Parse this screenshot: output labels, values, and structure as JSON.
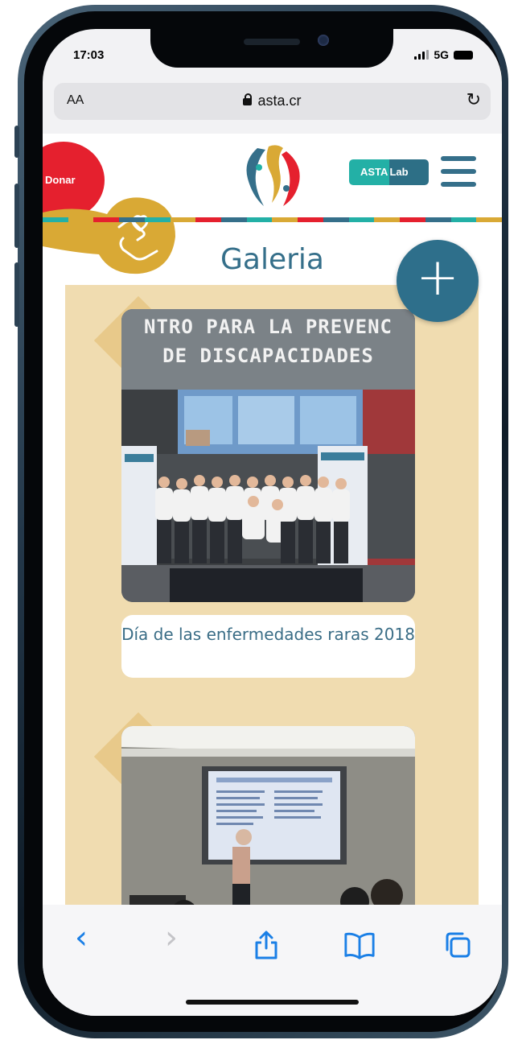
{
  "status_bar": {
    "time": "17:03",
    "network": "5G"
  },
  "browser": {
    "text_size": "AA",
    "domain": "asta.cr"
  },
  "header": {
    "donate_label": "Donar",
    "lab_part1": "ASTA",
    "lab_part2": "Lab"
  },
  "page": {
    "title": "Galeria",
    "add_button": "+"
  },
  "gallery": {
    "items": [
      {
        "sign_line1": "NTRO PARA LA PREVENC",
        "sign_line2": "DE DISCAPACIDADES",
        "caption": "Día de las enfermedades raras 2018"
      }
    ]
  },
  "toolbar": {
    "back": "‹",
    "forward": "›"
  },
  "colors": {
    "accent": "#356f8a",
    "donate": "#e5202e",
    "gold": "#d9a935",
    "beige": "#f0dcb0",
    "teal": "#23b0a6"
  }
}
